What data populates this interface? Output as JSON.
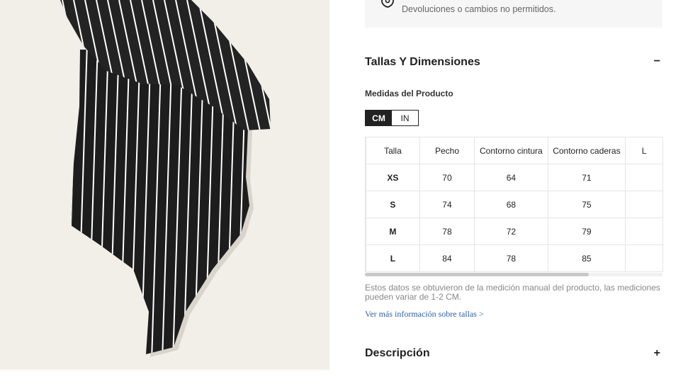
{
  "returns": {
    "icon": "shield-icon",
    "text": "Devoluciones o cambios no permitidos."
  },
  "sizes_section": {
    "title": "Tallas Y Dimensiones",
    "toggle": "−"
  },
  "measurements": {
    "heading": "Medidas del Producto",
    "units": [
      "CM",
      "IN"
    ],
    "selected_unit": "CM"
  },
  "table": {
    "headers": [
      "Talla",
      "Pecho",
      "Contorno cintura",
      "Contorno caderas",
      "L"
    ],
    "rows": [
      [
        "XS",
        "70",
        "64",
        "71",
        ""
      ],
      [
        "S",
        "74",
        "68",
        "75",
        ""
      ],
      [
        "M",
        "78",
        "72",
        "79",
        ""
      ],
      [
        "L",
        "84",
        "78",
        "85",
        ""
      ]
    ]
  },
  "note": "Estos datos se obtuvieron de la medición manual del producto, las mediciones pueden variar de 1-2 CM.",
  "more_link": "Ver más información sobre tallas >",
  "description_section": {
    "title": "Descripción",
    "toggle": "+"
  },
  "colors": {
    "image_bg": "#f2efe8",
    "garment": "#1d1d1d",
    "stripe": "#ffffff",
    "link": "#2c5ea8",
    "active_unit_bg": "#222222"
  }
}
